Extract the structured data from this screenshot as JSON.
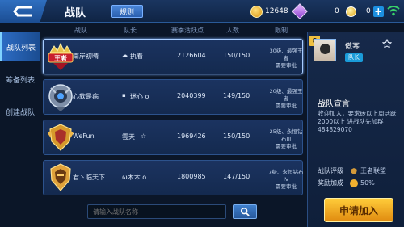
{
  "topbar": {
    "title": "战队",
    "rules_label": "规则",
    "gold": "12648",
    "diamonds": "0",
    "vouchers": "0",
    "plus": "+"
  },
  "sidebar": {
    "items": [
      {
        "label": "战队列表",
        "active": true
      },
      {
        "label": "筹备列表",
        "active": false
      },
      {
        "label": "创建战队",
        "active": false
      }
    ]
  },
  "table": {
    "headers": [
      "战队",
      "队长",
      "赛季活跃点",
      "人数",
      "限制"
    ],
    "rows": [
      {
        "team": "南岸初晴",
        "captain": "执着",
        "activity": "2126604",
        "members": "150/150",
        "limit_line1": "30级、最强王者",
        "limit_line2": "需要审批"
      },
      {
        "team": "心软是病",
        "captain": "迷心 ο",
        "activity": "2040399",
        "members": "149/150",
        "limit_line1": "20级、最强王者",
        "limit_line2": "需要审批"
      },
      {
        "team": "WeFun",
        "captain": "雲天",
        "activity": "1969426",
        "members": "150/150",
        "limit_line1": "25级、永恒钻石III",
        "limit_line2": "需要审批"
      },
      {
        "team": "君丶临天下",
        "captain": "ω木木 ο",
        "activity": "1800985",
        "members": "147/150",
        "limit_line1": "7级、永恒钻石IV",
        "limit_line2": "需要审批"
      }
    ]
  },
  "search": {
    "placeholder": "请输入战队名称"
  },
  "panel": {
    "level": "8",
    "captain_name": "傲寒",
    "captain_tag": "队长",
    "declaration_title": "战队宣言",
    "declaration_text": "收迎加入，要求砖以上周活跃2000以上 进战队先加群 484829070",
    "rank_label": "战队评级",
    "rank_value": "王者联盟",
    "reward_label": "奖励加成",
    "reward_value": "50%",
    "apply_label": "申请加入"
  },
  "colors": {
    "accent": "#2d6cc4",
    "apply": "#f0a820",
    "background": "#0b1628"
  }
}
